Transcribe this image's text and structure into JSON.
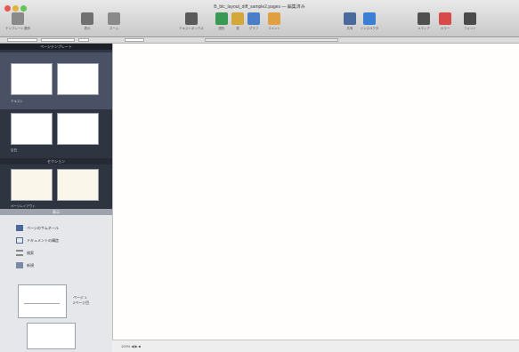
{
  "window": {
    "title": "B_blc_layout_diff_sample2.pages — 編集済み",
    "traffic_colors": [
      "#e8574d",
      "#e2b23a",
      "#62c554"
    ]
  },
  "toolbar": {
    "items": [
      {
        "label": "テンプレート選択",
        "icon": "new-doc-icon",
        "color": "#8a8a8a"
      },
      {
        "label": "表示",
        "icon": "view-icon",
        "color": "#707070"
      },
      {
        "label": "ズーム",
        "icon": "zoom-icon",
        "color": "#8a8a8a"
      },
      {
        "label": "テキストボックス",
        "icon": "text-box-icon",
        "color": "#5a5a5a"
      },
      {
        "label": "図形",
        "icon": "shape-icon",
        "color": "#3a9a54"
      },
      {
        "label": "表",
        "icon": "table-icon",
        "color": "#d4a73a"
      },
      {
        "label": "グラフ",
        "icon": "chart-icon",
        "color": "#4a7fc8"
      },
      {
        "label": "コメント",
        "icon": "comment-icon",
        "color": "#e0a040"
      },
      {
        "label": "共有",
        "icon": "share-icon",
        "color": "#4a6a9c"
      },
      {
        "label": "インスペクタ",
        "icon": "inspector-icon",
        "color": "#3a7fd4"
      },
      {
        "label": "メディア",
        "icon": "media-icon",
        "color": "#505050"
      },
      {
        "label": "カラー",
        "icon": "color-wheel-icon",
        "color": "#d84a4a"
      },
      {
        "label": "フォント",
        "icon": "font-icon",
        "color": "#4a4a4a"
      }
    ]
  },
  "sidebar": {
    "section_top": "ページテンプレート",
    "section_mid": "セクション",
    "labels": [
      "テキスト",
      "空白",
      "ページレイアウト"
    ],
    "divider_label": "表示",
    "lower_items": [
      {
        "label": "ページのサムネール",
        "icon": "thumbnails-icon"
      },
      {
        "label": "ドキュメントの構造",
        "icon": "structure-icon"
      },
      {
        "label": "検索",
        "icon": "search-list-icon"
      },
      {
        "label": "新規",
        "icon": "new-list-icon"
      }
    ],
    "page_thumb_label": "ページ 1\n2ページ目"
  },
  "statusbar": {
    "text": "100%  ◀ ▶ ■"
  }
}
